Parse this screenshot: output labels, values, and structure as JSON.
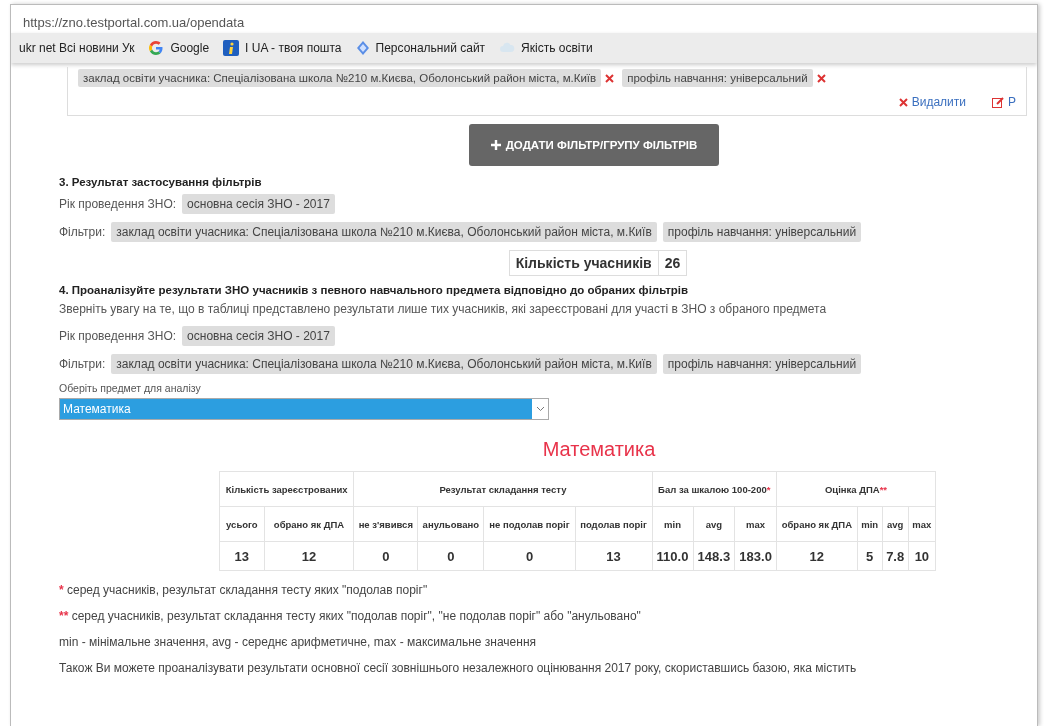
{
  "browser": {
    "url": "https://zno.testportal.com.ua/opendata",
    "bookmarks": [
      {
        "kind": "plain",
        "label": "ukr net Всі новини Ук"
      },
      {
        "kind": "google",
        "label": "Google"
      },
      {
        "kind": "info",
        "label": "I UA - твоя пошта"
      },
      {
        "kind": "diamond",
        "label": "Персональний сайт"
      },
      {
        "kind": "cloud",
        "label": "Якість освіти"
      }
    ]
  },
  "filter_box": {
    "tags": [
      "заклад освіти учасника: Спеціалізована школа №210 м.Києва, Оболонський район міста, м.Київ",
      "профіль навчання: універсальний"
    ],
    "actions": [
      {
        "kind": "delete",
        "label": "Видалити"
      },
      {
        "kind": "edit",
        "label": "Р"
      }
    ]
  },
  "add_filter_button": {
    "label": "ДОДАТИ ФІЛЬТР/ГРУПУ ФІЛЬТРІВ"
  },
  "section3": {
    "heading": "3. Результат застосування фільтрів",
    "year_label": "Рік проведення ЗНО:",
    "year_value": "основна сесія ЗНО - 2017",
    "filters_label": "Фільтри:",
    "filters": [
      "заклад освіти учасника: Спеціалізована школа №210 м.Києва, Оболонський район міста, м.Київ",
      "профіль навчання: універсальний"
    ],
    "count_label": "Кількість учасників",
    "count_value": "26"
  },
  "section4": {
    "heading": "4. Проаналізуйте результати ЗНО учасників з певного навчального предмета відповідно до обраних фільтрів",
    "note": "Зверніть увагу на те, що в таблиці представлено результати лише тих учасників, які зареєстровані для участі в ЗНО з обраного предмета",
    "year_label": "Рік проведення ЗНО:",
    "year_value": "основна сесія ЗНО - 2017",
    "filters_label": "Фільтри:",
    "filters": [
      "заклад освіти учасника: Спеціалізована школа №210 м.Києва, Оболонський район міста, м.Київ",
      "профіль навчання: універсальний"
    ],
    "subject_label": "Оберіть предмет для аналізу",
    "subject_value": "Математика"
  },
  "results": {
    "title": "Математика",
    "groups": [
      {
        "label": "Кількість зареєстрованих",
        "columns": [
          "усього",
          "обрано як ДПА"
        ]
      },
      {
        "label": "Результат складання тесту",
        "columns": [
          "не з'явився",
          "анульовано",
          "не подолав поріг",
          "подолав поріг"
        ]
      },
      {
        "label": "Бал за шкалою 100-200",
        "mark": "*",
        "columns": [
          "min",
          "avg",
          "max"
        ]
      },
      {
        "label": "Оцінка ДПА",
        "mark": "**",
        "columns": [
          "обрано як ДПА",
          "min",
          "avg",
          "max"
        ]
      }
    ],
    "row": [
      "13",
      "12",
      "0",
      "0",
      "0",
      "13",
      "110.0",
      "148.3",
      "183.0",
      "12",
      "5",
      "7.8",
      "10"
    ]
  },
  "footnotes": [
    {
      "mark": "*",
      "text": "серед учасників, результат складання тесту яких \"подолав поріг\""
    },
    {
      "mark": "**",
      "text": "серед учасників, результат складання тесту яких \"подолав поріг\", \"не подолав поріг\" або \"анульовано\""
    },
    {
      "text": "min - мінімальне значення, avg - середнє арифметичне, max - максимальне значення"
    },
    {
      "text": "Також Ви можете проаналізувати результати основної сесії зовнішнього незалежного оцінювання 2017 року, скориставшись базою, яка містить"
    }
  ]
}
